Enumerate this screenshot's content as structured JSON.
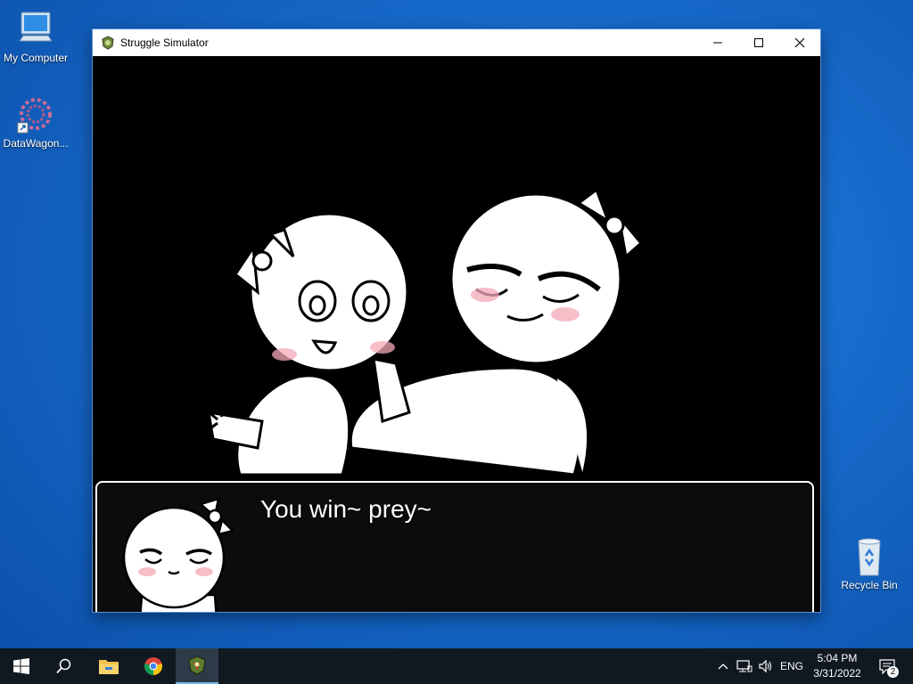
{
  "desktop": {
    "icons": [
      {
        "label": "My Computer",
        "icon": "computer-icon"
      },
      {
        "label": "DataWagon...",
        "icon": "datawagon-icon"
      },
      {
        "label": "Recycle Bin",
        "icon": "recycle-bin-icon"
      }
    ]
  },
  "window": {
    "title": "Struggle Simulator",
    "controls": [
      "minimize-icon",
      "maximize-icon",
      "close-icon"
    ]
  },
  "game": {
    "message": "You win~ prey~"
  },
  "taskbar": {
    "apps": [
      "start-icon",
      "search-icon",
      "file-explorer-icon",
      "chrome-icon",
      "struggle-simulator-icon"
    ],
    "tray": {
      "language": "ENG",
      "time": "5:04 PM",
      "date": "3/31/2022",
      "notification_count": "2"
    }
  },
  "colors": {
    "taskbar_bg": "#101820",
    "desktop_blue": "#1669c9",
    "msgbox_border": "#ffffff"
  }
}
